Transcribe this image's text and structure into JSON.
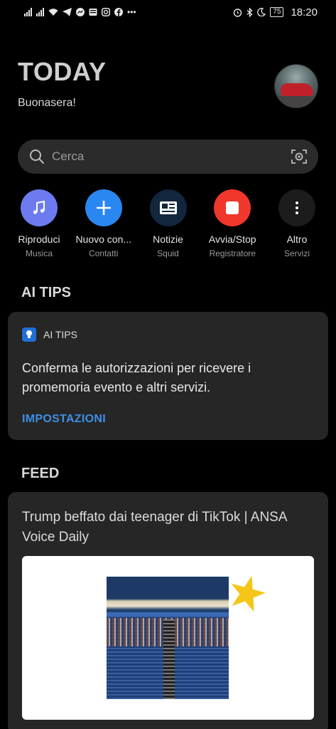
{
  "statusbar": {
    "battery": "75",
    "time": "18:20",
    "icons": [
      "signal-icon",
      "signal-icon",
      "wifi-icon",
      "telegram-icon",
      "messenger-icon",
      "news-icon",
      "instagram-icon",
      "facebook-icon",
      "more-dots-icon",
      "alarm-icon",
      "bluetooth-icon",
      "moon-icon",
      "battery-icon"
    ]
  },
  "header": {
    "title": "TODAY",
    "greeting": "Buonasera!"
  },
  "search": {
    "placeholder": "Cerca"
  },
  "shortcuts": [
    {
      "label": "Riproduci",
      "sub": "Musica",
      "icon": "music-note-icon",
      "color": "#6c7bf0"
    },
    {
      "label": "Nuovo con...",
      "sub": "Contatti",
      "icon": "plus-icon",
      "color": "#2a86f0"
    },
    {
      "label": "Notizie",
      "sub": "Squid",
      "icon": "newspaper-icon",
      "color": "#12263d"
    },
    {
      "label": "Avvia/Stop",
      "sub": "Registratore",
      "icon": "stop-icon",
      "color": "#f0372b"
    },
    {
      "label": "Altro",
      "sub": "Servizi",
      "icon": "more-vertical-icon",
      "color": "#1c1c1c"
    }
  ],
  "ai_tips": {
    "section_title": "AI TIPS",
    "card_name": "AI TIPS",
    "body": "Conferma le autorizzazioni per ricevere i promemoria evento e altri servizi.",
    "action": "IMPOSTAZIONI"
  },
  "feed": {
    "section_title": "FEED",
    "item_title": "Trump beffato dai teenager di TikTok | ANSA Voice Daily"
  },
  "colors": {
    "background": "#000000",
    "card": "#262626",
    "accent_link": "#3d8fe6"
  }
}
